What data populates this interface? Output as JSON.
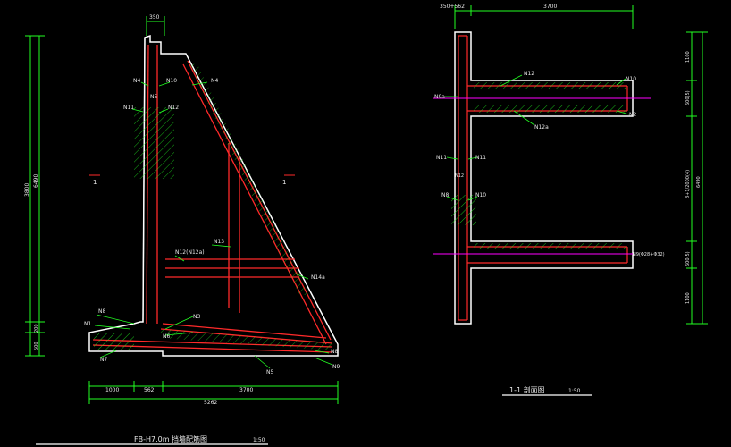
{
  "colors": {
    "background": "#000000",
    "concrete_outline": "#ffffff",
    "rebar": "#ff2a2a",
    "dimension": "#22ff22",
    "text": "#e6e6e6",
    "marker": "#ffff00",
    "section_line": "#ff00ff"
  },
  "left_view": {
    "title": "FB-H7.0m 挡墙配筋图",
    "scale": "1:50",
    "dim_top": "350",
    "dim_bottom": [
      "1000",
      "562",
      "3700",
      "5262"
    ],
    "dim_left": [
      "3800",
      "6490",
      "200",
      "500"
    ],
    "section_marks": [
      "1",
      "1"
    ],
    "labels": [
      "N4",
      "N10",
      "N4",
      "N5",
      "N11",
      "N12",
      "N13",
      "N12(N12a)",
      "N14a",
      "N8",
      "N1",
      "N3",
      "N7",
      "N6",
      "N8",
      "N9",
      "N5"
    ]
  },
  "right_view": {
    "title": "1-1 剖面图",
    "scale": "1:50",
    "dim_top": [
      "350+562",
      "3700"
    ],
    "dim_right": [
      "1100",
      "600(5)",
      "3+1/2000(4)",
      "6490",
      "600(5)",
      "1100"
    ],
    "labels": [
      "N12",
      "N10",
      "N9a",
      "N2",
      "N12a",
      "N11",
      "N11",
      "N8",
      "N10",
      "N12",
      "N9(Φ28+Φ32)"
    ]
  }
}
